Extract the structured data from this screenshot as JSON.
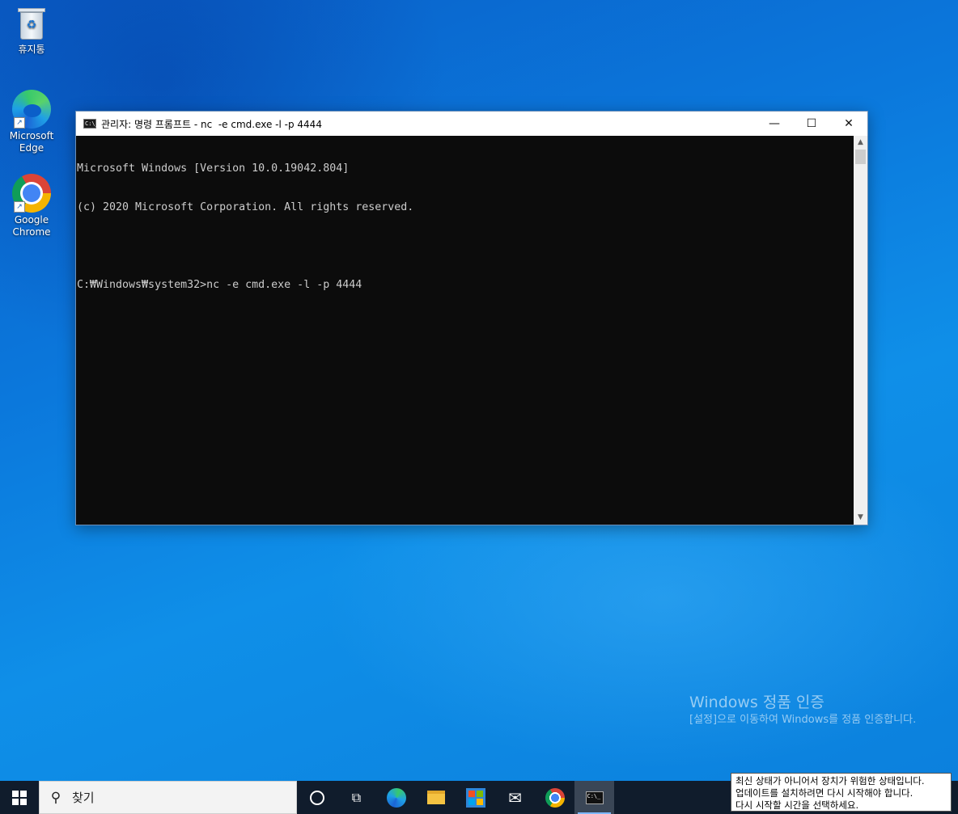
{
  "desktop": {
    "icons": [
      {
        "label": "휴지통",
        "icon": "recycle-bin-icon"
      },
      {
        "label": "Microsoft Edge",
        "icon": "edge-icon"
      },
      {
        "label": "Google Chrome",
        "icon": "chrome-icon"
      }
    ]
  },
  "window": {
    "icon_glyph": "C:\\_",
    "title": "관리자: 명령 프롬프트 - nc  -e cmd.exe -l -p 4444",
    "minimize_glyph": "—",
    "maximize_glyph": "☐",
    "close_glyph": "✕",
    "console_lines": [
      "Microsoft Windows [Version 10.0.19042.804]",
      "(c) 2020 Microsoft Corporation. All rights reserved.",
      "",
      "C:₩Windows₩system32>nc -e cmd.exe -l -p 4444"
    ],
    "scroll_up": "▲",
    "scroll_down": "▼"
  },
  "watermark": {
    "title": "Windows 정품 인증",
    "subtitle": "[설정]으로 이동하여 Windows를 정품 인증합니다."
  },
  "taskbar": {
    "search_placeholder": "찾기",
    "search_icon": "search-icon",
    "buttons": [
      "cortana-icon",
      "task-view-icon",
      "edge-icon",
      "file-explorer-icon",
      "store-icon",
      "mail-icon",
      "chrome-icon",
      "command-prompt-icon"
    ]
  },
  "notification": {
    "lines": [
      "최신 상태가 아니어서 장치가 위험한 상태입니다.",
      "업데이트를 설치하려면 다시 시작해야 합니다.",
      "다시 시작할 시간을 선택하세요."
    ]
  },
  "colors": {
    "console_bg": "#0c0c0c",
    "console_fg": "#cccccc",
    "taskbar_bg": "#101c2c",
    "desktop_blue": "#0b78dc"
  }
}
